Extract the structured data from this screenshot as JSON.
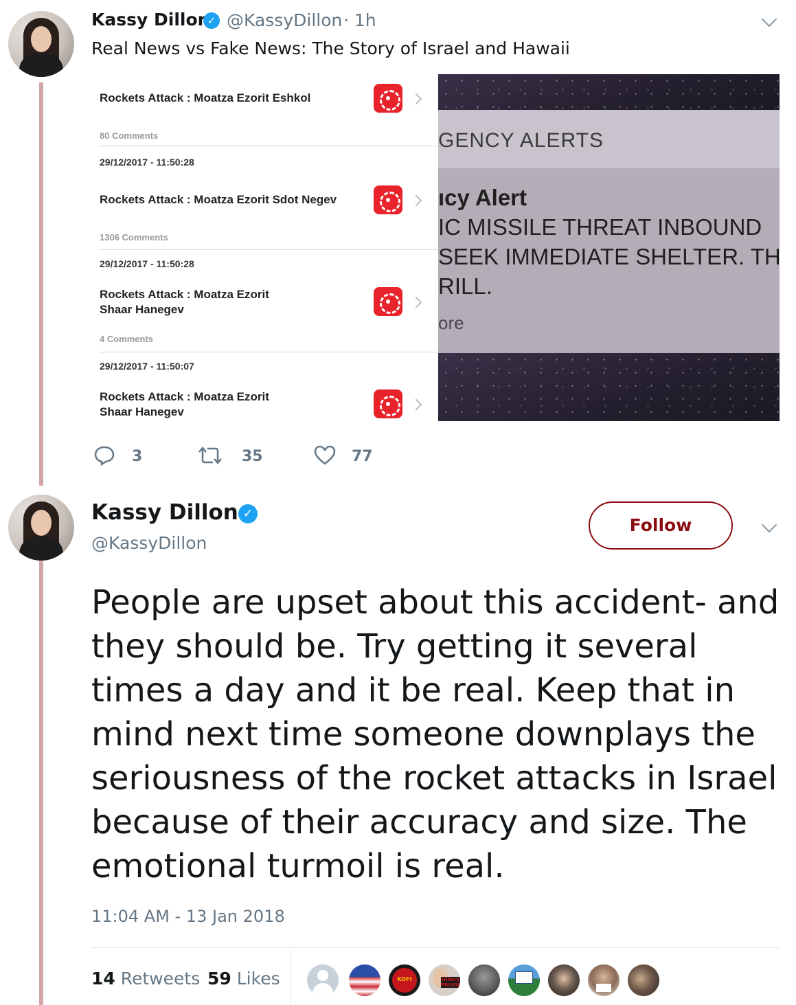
{
  "tweet1": {
    "name": "Kassy Dillon",
    "handle": "@KassyDillon",
    "time": "· 1h",
    "text": "Real News vs Fake News: The Story of Israel and Hawaii",
    "media": {
      "israel_alerts": [
        {
          "title_lines": [
            "Rockets Attack : Moatza Ezorit Eshkol"
          ],
          "comments": "80 Comments",
          "timestamp": "29/12/2017 - 11:50:28"
        },
        {
          "title_lines": [
            "Rockets Attack : Moatza Ezorit Sdot Negev"
          ],
          "comments": "1306 Comments",
          "timestamp": "29/12/2017 - 11:50:28"
        },
        {
          "title_lines": [
            "Rockets Attack : Moatza Ezorit",
            "Shaar Hanegev"
          ],
          "comments": "4 Comments",
          "timestamp": "29/12/2017 - 11:50:07"
        },
        {
          "title_lines": [
            "Rockets Attack : Moatza Ezorit",
            "Shaar Hanegev"
          ],
          "comments": "",
          "timestamp": ""
        }
      ],
      "hawaii_alert": {
        "header": "GENCY ALERTS",
        "title": "ıcy Alert",
        "lines": [
          "IC MISSILE THREAT INBOUND",
          "SEEK IMMEDIATE SHELTER. TH",
          "RILL."
        ],
        "more": "ore"
      }
    },
    "actions": {
      "replies": "3",
      "retweets": "35",
      "likes": "77"
    }
  },
  "tweet2": {
    "name": "Kassy Dillon",
    "handle": "@KassyDillon",
    "follow_label": "Follow",
    "text": "People are upset about this accident- and they should be. Try getting it several times a day and it be real. Keep that in mind next time someone downplays the seriousness of the rocket attacks in Israel because of their accuracy and size. The emotional turmoil is real.",
    "timestamp": "11:04 AM - 13 Jan 2018",
    "retweets_count": "14",
    "retweets_label": "Retweets",
    "likes_count": "59",
    "likes_label": "Likes"
  },
  "colors": {
    "thread_line": "#d3a5a5",
    "follow_accent": "#8b0c10",
    "verified": "#1da1f2",
    "alert_red": "#e8232b"
  },
  "likers_avatar_texts": [
    "Hillary PRISON",
    "KOFI"
  ]
}
